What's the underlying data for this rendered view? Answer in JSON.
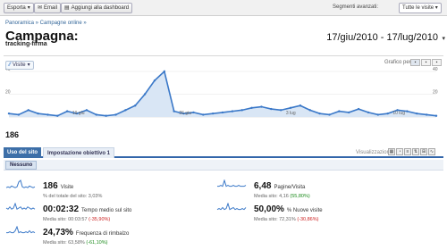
{
  "toolbar": {
    "export_label": "Esporta",
    "email_label": "Email",
    "dashboard_label": "Aggiungi alla dashboard",
    "segments_label": "Segmenti avanzati:",
    "segments_value": "Tutte le visite"
  },
  "breadcrumb": "Panoramica » Campagne online »",
  "page": {
    "title": "Campagna:",
    "subtitle": "tracking-firma",
    "date_range": "17/giu/2010 - 17/lug/2010"
  },
  "graph": {
    "metric_label": "Visite",
    "graph_by_label": "Grafico per:",
    "by_buttons": [
      "",
      "",
      ""
    ]
  },
  "chart_data": {
    "type": "area",
    "series": [
      {
        "values": [
          3,
          2,
          6,
          3,
          2,
          1,
          5,
          3,
          6,
          2,
          1,
          2,
          6,
          10,
          20,
          32,
          40,
          5,
          3,
          4,
          2,
          3,
          4,
          5,
          6,
          8,
          9,
          7,
          6,
          8,
          10,
          6,
          3,
          2,
          5,
          4,
          7,
          4,
          2,
          3,
          6,
          5,
          3,
          2,
          1
        ]
      }
    ],
    "x_tick_labels": [
      "19 giu",
      "26 giu",
      "3 lug",
      "10 lug"
    ],
    "y_tick_labels": [
      "20",
      "40"
    ],
    "ylim": [
      0,
      40
    ],
    "grid": true
  },
  "totals": {
    "visits_total": "186"
  },
  "tabs": {
    "tab1": "Uso del sito",
    "tab2": "Impostazione obiettivo 1",
    "view_label": "Visualizzazione:",
    "filter_label": "Nessuno"
  },
  "stats": {
    "visits": {
      "value": "186",
      "label": "Visite",
      "sub": "% del totale del sito: 3,03%"
    },
    "pages": {
      "value": "6,48",
      "label": "Pagine/Visita",
      "sub_prefix": "Media sito: 4,16",
      "delta": "(55,80%)"
    },
    "time": {
      "value": "00:02:32",
      "label": "Tempo medio sul sito",
      "sub_prefix": "Media sito: 00:03:57",
      "delta": "(-35,90%)"
    },
    "new_visits": {
      "value": "50,00%",
      "label": "% Nuove visite",
      "sub_prefix": "Media sito: 72,31%",
      "delta": "(-30,86%)"
    },
    "bounce": {
      "value": "24,73%",
      "label": "Frequenza di rimbalzo",
      "sub_prefix": "Media sito: 63,58%",
      "delta": "(-61,10%)"
    }
  },
  "colors": {
    "line": "#3a78c8",
    "fill": "#d9e6f5",
    "good": "#1a8a1a",
    "bad": "#cc2222"
  }
}
